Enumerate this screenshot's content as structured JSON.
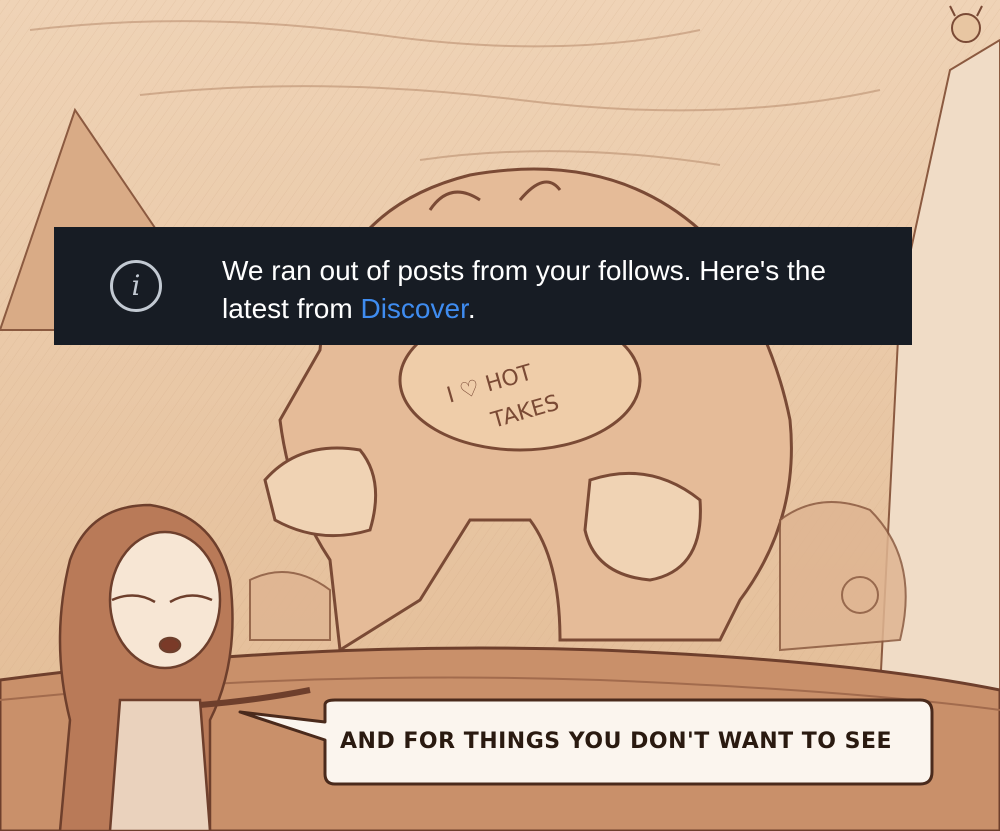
{
  "notice": {
    "icon": "info-icon",
    "message_before": "We ran out of posts from your follows. Here's the latest from ",
    "link_text": "Discover",
    "message_after": "."
  },
  "comic": {
    "belly_text_line1": "I ♡ HOT",
    "belly_text_line2": "TAKES",
    "speech_bubble": "AND FOR THINGS YOU DON'T WANT TO SEE"
  },
  "colors": {
    "banner_bg": "#171c24",
    "link": "#3f8cf0",
    "paper": "#e8c6a2",
    "ink": "#7a4a35"
  }
}
